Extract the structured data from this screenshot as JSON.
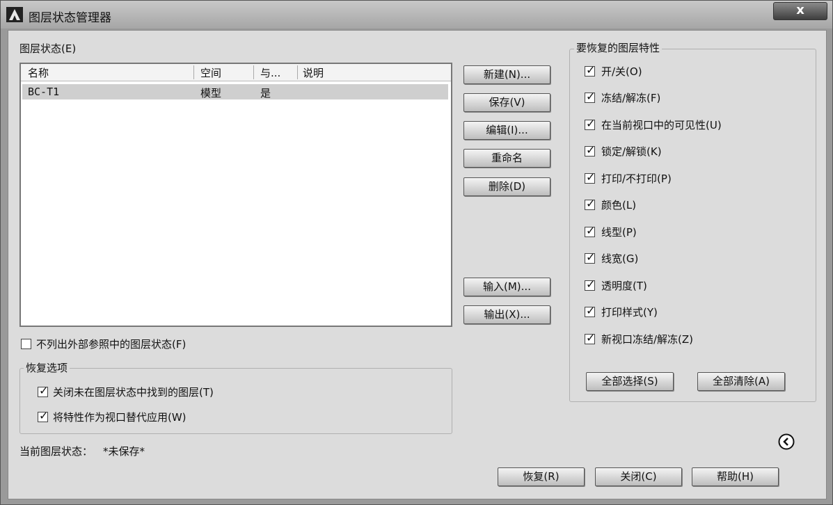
{
  "window": {
    "title": "图层状态管理器",
    "close_label": "x"
  },
  "states_panel": {
    "label": "图层状态(E)",
    "columns": [
      "名称",
      "空间",
      "与...",
      "说明"
    ],
    "rows": [
      {
        "name": "BC-T1",
        "space": "模型",
        "same": "是",
        "desc": ""
      }
    ]
  },
  "buttons": {
    "new": "新建(N)...",
    "save": "保存(V)",
    "edit": "编辑(I)...",
    "rename": "重命名",
    "delete": "删除(D)",
    "import": "输入(M)...",
    "export": "输出(X)..."
  },
  "options": {
    "no_xref": {
      "label": "不列出外部参照中的图层状态(F)",
      "checked": false
    },
    "restore_group": "恢复选项",
    "turn_off": {
      "label": "关闭未在图层状态中找到的图层(T)",
      "checked": true
    },
    "apply_override": {
      "label": "将特性作为视口替代应用(W)",
      "checked": true
    }
  },
  "current_state": {
    "label": "当前图层状态：",
    "value": "*未保存*"
  },
  "properties": {
    "group_title": "要恢复的图层特性",
    "items": [
      {
        "label": "开/关(O)",
        "checked": true
      },
      {
        "label": "冻结/解冻(F)",
        "checked": true
      },
      {
        "label": "在当前视口中的可见性(U)",
        "checked": true
      },
      {
        "label": "锁定/解锁(K)",
        "checked": true
      },
      {
        "label": "打印/不打印(P)",
        "checked": true
      },
      {
        "label": "颜色(L)",
        "checked": true
      },
      {
        "label": "线型(P)",
        "checked": true
      },
      {
        "label": "线宽(G)",
        "checked": true
      },
      {
        "label": "透明度(T)",
        "checked": true
      },
      {
        "label": "打印样式(Y)",
        "checked": true
      },
      {
        "label": "新视口冻结/解冻(Z)",
        "checked": true
      }
    ],
    "select_all": "全部选择(S)",
    "clear_all": "全部清除(A)"
  },
  "footer": {
    "restore": "恢复(R)",
    "close": "关闭(C)",
    "help": "帮助(H)"
  },
  "icons": {
    "app": "autocad-logo-icon",
    "collapse": "chevron-left-circle-icon"
  }
}
